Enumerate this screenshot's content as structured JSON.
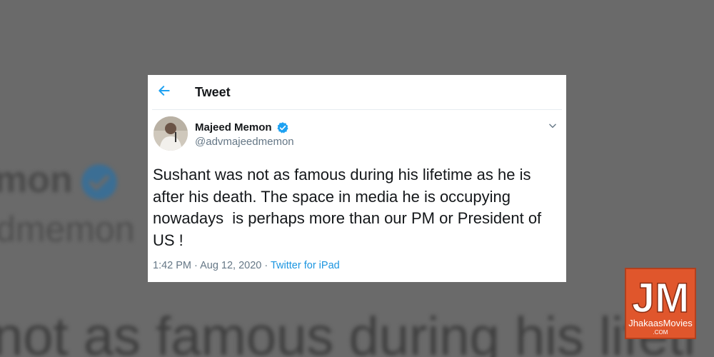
{
  "background": {
    "name_fragment": "mon",
    "handle_fragment": "dmemon",
    "text_fragment": "not as famous during his lifeti"
  },
  "header": {
    "title": "Tweet",
    "back_icon": "arrow-left-icon"
  },
  "author": {
    "name": "Majeed Memon",
    "handle": "@advmajeedmemon",
    "verified_icon": "verified-badge-icon"
  },
  "tweet": {
    "text": "Sushant was not as famous during his lifetime as he is\nafter his death. The space in media he is occupying\nnowadays  is perhaps more than our PM or President of\nUS !",
    "time": "1:42 PM",
    "separator1": " · ",
    "date": "Aug 12, 2020",
    "separator2": " · ",
    "source": "Twitter for iPad"
  },
  "watermark": {
    "letters": "JM",
    "name": "JhakaasMovies",
    "domain": ".COM"
  },
  "colors": {
    "accent": "#1da1f2",
    "link": "#1b95e0",
    "logo_bg": "#e0562c"
  }
}
